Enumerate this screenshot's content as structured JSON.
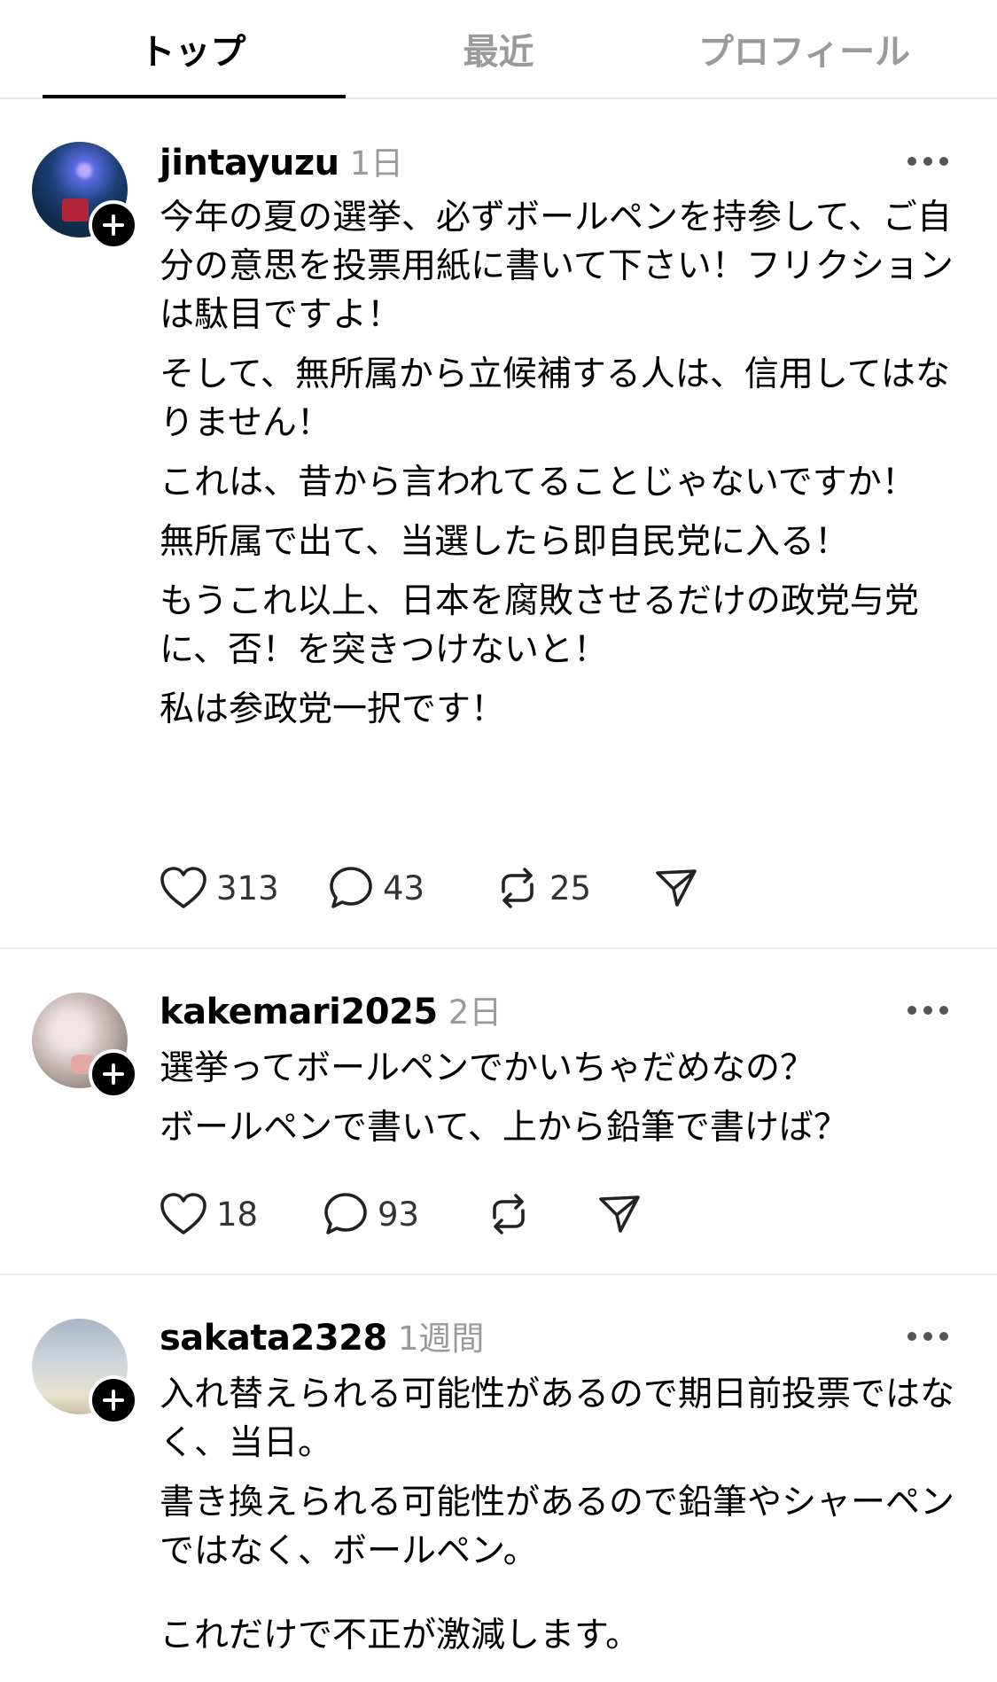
{
  "tabs": [
    {
      "label": "トップ",
      "active": true
    },
    {
      "label": "最近",
      "active": false
    },
    {
      "label": "プロフィール",
      "active": false
    }
  ],
  "posts": [
    {
      "username": "jintayuzu",
      "time": "1日",
      "paragraphs": [
        "今年の夏の選挙、必ずボールペンを持参して、ご自分の意思を投票用紙に書いて下さい！フリクションは駄目ですよ！",
        "そして、無所属から立候補する人は、信用してはなりません！",
        "これは、昔から言われてることじゃないですか！",
        "無所属で出て、当選したら即自民党に入る！",
        "もうこれ以上、日本を腐敗させるだけの政党与党に、否！を突きつけないと！",
        "私は参政党一択です！"
      ],
      "likes": "313",
      "comments": "43",
      "reposts": "25"
    },
    {
      "username": "kakemari2025",
      "time": "2日",
      "paragraphs": [
        "選挙ってボールペンでかいちゃだめなの？",
        "ボールペンで書いて、上から鉛筆で書けば？"
      ],
      "likes": "18",
      "comments": "93",
      "reposts": ""
    },
    {
      "username": "sakata2328",
      "time": "1週間",
      "paragraphs": [
        "入れ替えられる可能性があるので期日前投票ではなく、当日。",
        "書き換えられる可能性があるので鉛筆やシャーペンではなく、ボールペン。",
        "これだけで不正が激減します。"
      ]
    }
  ],
  "icons": {
    "follow": "plus-icon",
    "more": "ellipsis-icon",
    "like": "heart-icon",
    "comment": "comment-bubble-icon",
    "repost": "repost-icon",
    "share": "send-icon"
  },
  "colors": {
    "text": "#000000",
    "muted": "#9a9a9a",
    "divider": "#e6e6e6"
  }
}
